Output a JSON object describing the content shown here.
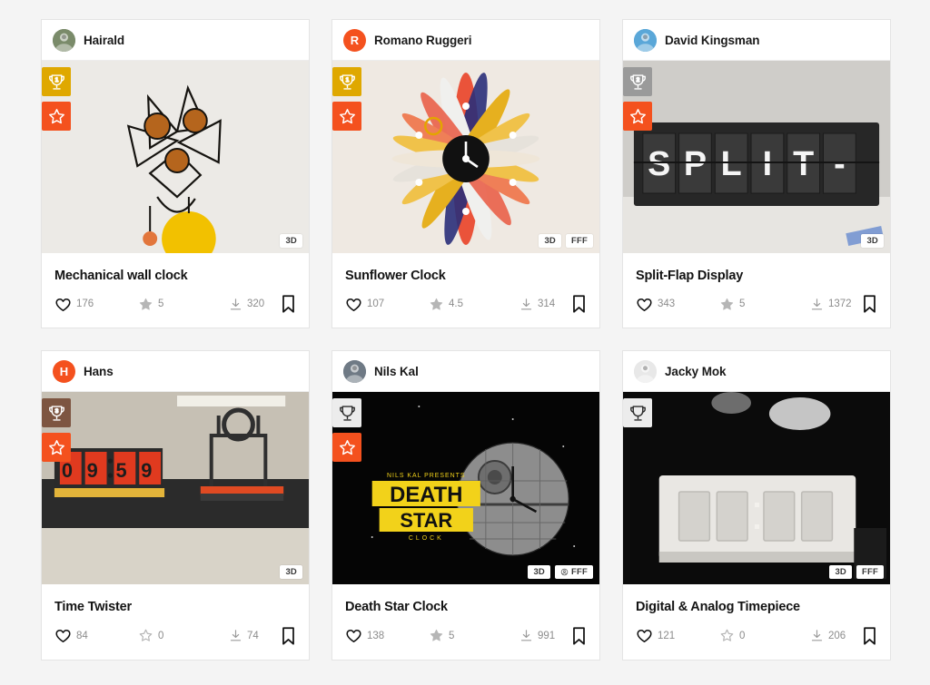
{
  "page": {
    "background": "#f4f4f4",
    "accent": "#f4511e"
  },
  "icons": {
    "trophy": "trophy-icon",
    "star": "star-icon",
    "heart": "heart-icon",
    "download": "download-icon",
    "bookmark": "bookmark-icon"
  },
  "cards": [
    {
      "author": "Hairald",
      "avatar": {
        "type": "photo",
        "letter": "",
        "bg": "#7a8b6a"
      },
      "badges": [
        {
          "name": "trophy-badge",
          "kind": "trophy",
          "rank": "1",
          "color": "#dfa800"
        },
        {
          "name": "star-badge",
          "kind": "star",
          "rank": "",
          "color": "#f4511e"
        }
      ],
      "tags": [
        "3D"
      ],
      "tag_icons": [
        "none"
      ],
      "title": "Mechanical wall clock",
      "likes": "176",
      "rating": "5",
      "rating_filled": true,
      "downloads": "320"
    },
    {
      "author": "Romano Ruggeri",
      "avatar": {
        "type": "letter",
        "letter": "R",
        "bg": "#f4511e"
      },
      "badges": [
        {
          "name": "trophy-badge",
          "kind": "trophy",
          "rank": "1",
          "color": "#dfa800"
        },
        {
          "name": "star-badge",
          "kind": "star",
          "rank": "",
          "color": "#f4511e"
        }
      ],
      "tags": [
        "3D",
        "FFF"
      ],
      "tag_icons": [
        "none",
        "none"
      ],
      "title": "Sunflower Clock",
      "likes": "107",
      "rating": "4.5",
      "rating_filled": true,
      "downloads": "314"
    },
    {
      "author": "David Kingsman",
      "avatar": {
        "type": "photo",
        "letter": "",
        "bg": "#5aa7d8"
      },
      "badges": [
        {
          "name": "trophy-badge",
          "kind": "trophy",
          "rank": "2",
          "color": "#9a9a9a"
        },
        {
          "name": "star-badge",
          "kind": "star",
          "rank": "",
          "color": "#f4511e"
        }
      ],
      "tags": [
        "3D"
      ],
      "tag_icons": [
        "none"
      ],
      "title": "Split-Flap Display",
      "likes": "343",
      "rating": "5",
      "rating_filled": true,
      "downloads": "1372"
    },
    {
      "author": "Hans",
      "avatar": {
        "type": "letter",
        "letter": "H",
        "bg": "#f4511e"
      },
      "badges": [
        {
          "name": "trophy-badge",
          "kind": "trophy",
          "rank": "3",
          "color": "#7d5541"
        },
        {
          "name": "star-badge",
          "kind": "star",
          "rank": "",
          "color": "#f4511e"
        }
      ],
      "tags": [
        "3D"
      ],
      "tag_icons": [
        "none"
      ],
      "title": "Time Twister",
      "likes": "84",
      "rating": "0",
      "rating_filled": false,
      "downloads": "74"
    },
    {
      "author": "Nils Kal",
      "avatar": {
        "type": "photo",
        "letter": "",
        "bg": "#6f7a85"
      },
      "badges": [
        {
          "name": "trophy-badge",
          "kind": "trophy",
          "rank": "",
          "color": "#ececec"
        },
        {
          "name": "star-badge",
          "kind": "star",
          "rank": "",
          "color": "#f4511e"
        }
      ],
      "tags": [
        "3D",
        "FFF"
      ],
      "tag_icons": [
        "none",
        "no-commercial"
      ],
      "title": "Death Star Clock",
      "likes": "138",
      "rating": "5",
      "rating_filled": true,
      "downloads": "991"
    },
    {
      "author": "Jacky Mok",
      "avatar": {
        "type": "photo",
        "letter": "",
        "bg": "#e8e8e8"
      },
      "badges": [
        {
          "name": "trophy-badge",
          "kind": "trophy",
          "rank": "",
          "color": "#ececec"
        }
      ],
      "tags": [
        "3D",
        "FFF"
      ],
      "tag_icons": [
        "none",
        "none"
      ],
      "title": "Digital & Analog Timepiece",
      "likes": "121",
      "rating": "0",
      "rating_filled": false,
      "downloads": "206"
    }
  ]
}
